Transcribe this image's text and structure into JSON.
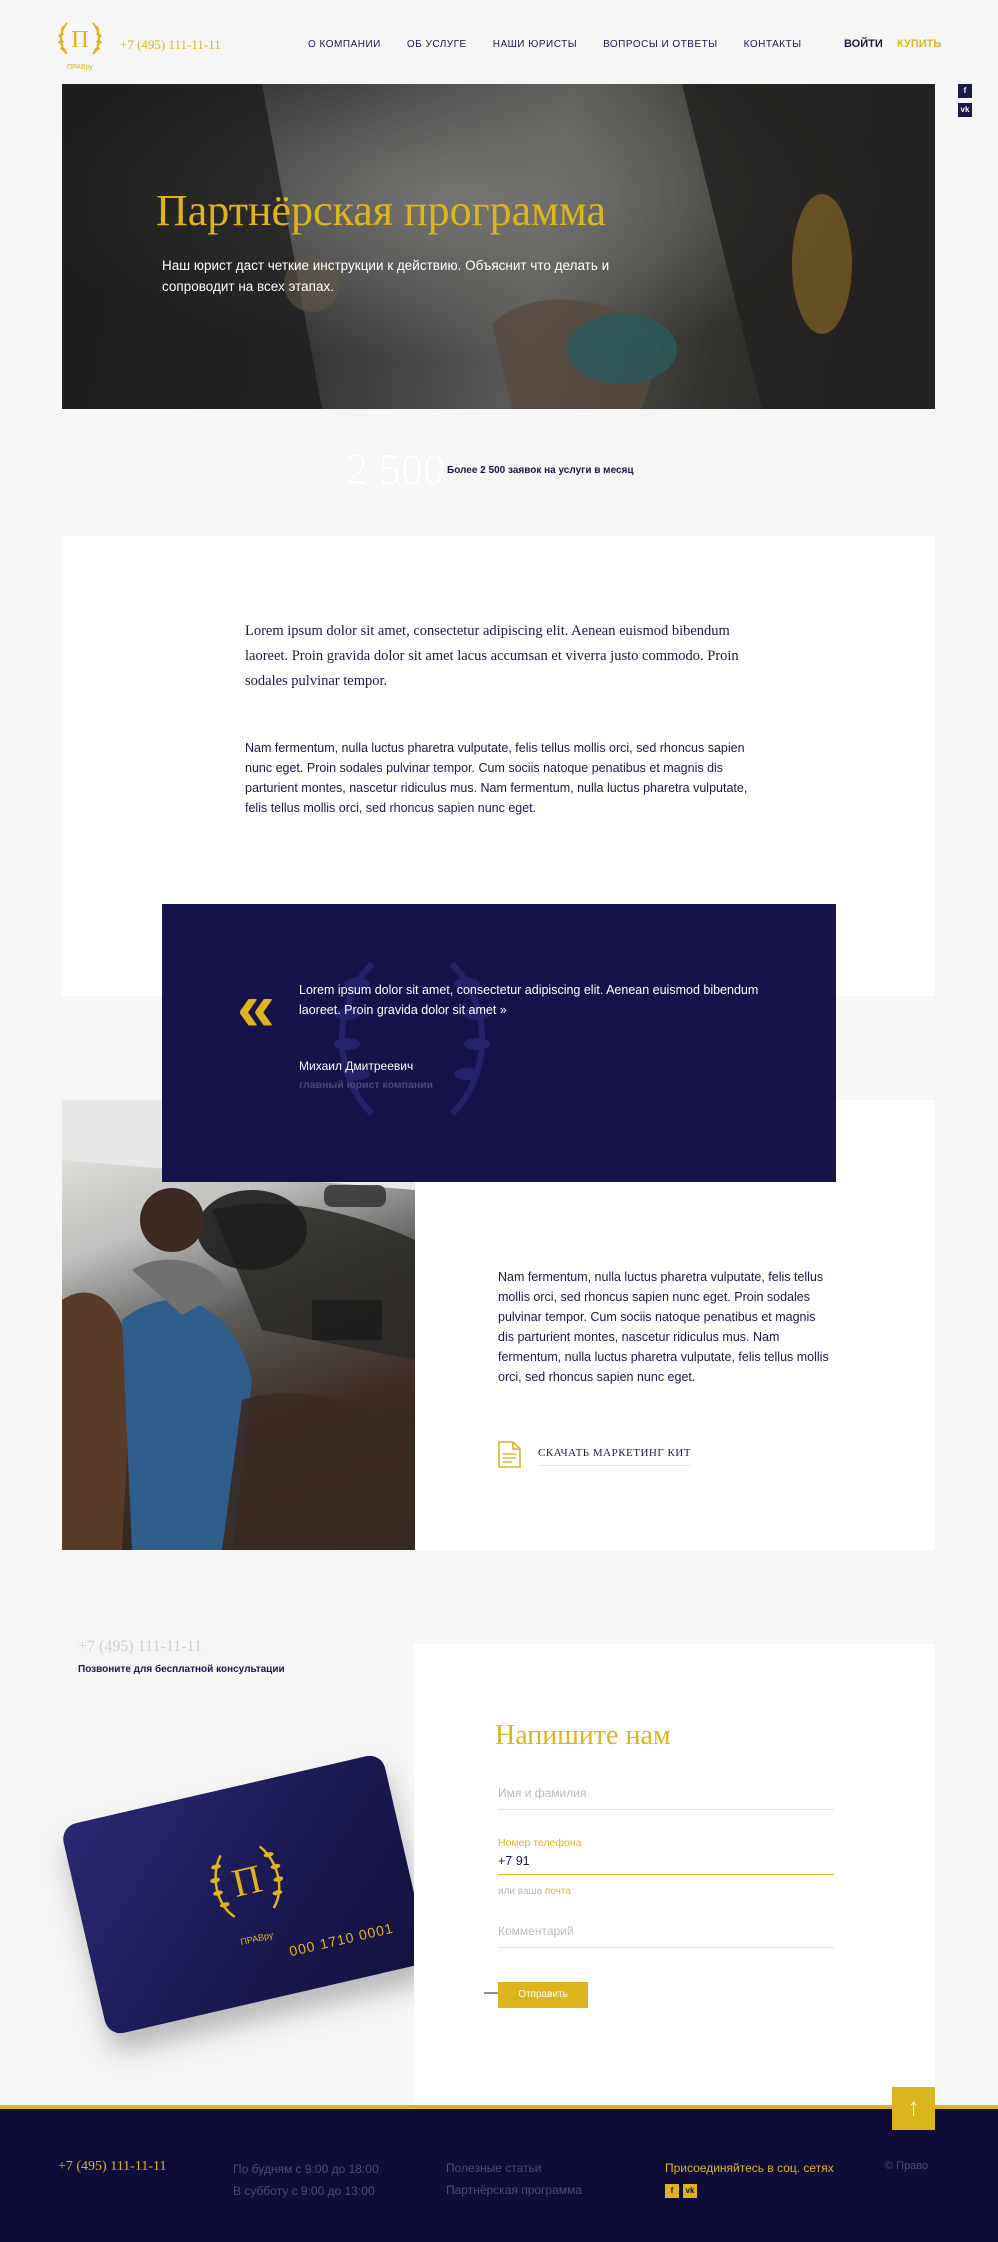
{
  "header": {
    "logo_letter": "П",
    "logo_word": "ПРАВру",
    "phone": "+7 (495) 111-11-11",
    "nav": [
      "О компании",
      "Об услуге",
      "Наши юристы",
      "Вопросы и ответы",
      "Контакты"
    ],
    "login": "ВОЙТИ",
    "buy": "КУПИТЬ",
    "side_social": [
      "f",
      "vk"
    ]
  },
  "hero": {
    "title": "Партнёрская программа",
    "subtitle": "Наш юрист даст четкие инструкции к действию. Объяснит что делать и сопроводит на всех этапах."
  },
  "stat": {
    "number": "2 500",
    "text": "Более 2 500 заявок на услуги  в месяц"
  },
  "intro": {
    "lead": "Lorem ipsum dolor sit amet, consectetur adipiscing elit. Aenean euismod bibendum laoreet. Proin gravida dolor sit amet lacus accumsan et viverra justo commodo. Proin sodales pulvinar tempor.",
    "body": "Nam fermentum, nulla luctus pharetra vulputate, felis tellus mollis orci, sed rhoncus sapien nunc eget. Proin sodales pulvinar tempor. Cum sociis natoque penatibus et magnis dis parturient montes, nascetur ridiculus mus. Nam fermentum, nulla luctus pharetra vulputate, felis tellus mollis orci, sed rhoncus sapien nunc eget."
  },
  "quote": {
    "mark": "«",
    "text": "Lorem ipsum dolor sit amet, consectetur adipiscing elit. Aenean euismod bibendum laoreet. Proin gravida dolor sit amet »",
    "author": "Михаил Дмитреевич",
    "role": "главный юрист компании"
  },
  "kit": {
    "body": "Nam fermentum, nulla luctus pharetra vulputate, felis tellus mollis orci, sed rhoncus sapien nunc eget. Proin sodales pulvinar tempor. Cum sociis natoque penatibus et magnis dis parturient montes, nascetur ridiculus mus. Nam fermentum, nulla luctus pharetra vulputate, felis tellus mollis orci, sed rhoncus sapien nunc eget.",
    "link": "Скачать маркетинг кит"
  },
  "contact": {
    "phone": "+7 (495) 111-11-11",
    "note": "Позвоните для бесплатной консультации",
    "card_number": "000 1710 0001",
    "card_letter": "П",
    "card_word": "ПРАВру"
  },
  "form": {
    "title": "Напишите нам",
    "name_placeholder": "Имя и фамилия",
    "phone_label": "Номер телефона",
    "phone_value": "+7 91",
    "hint_prefix": "или ваша",
    "hint_link": "почта",
    "comment_placeholder": "Комментарий",
    "submit": "Отправить"
  },
  "to_top": "↑",
  "footer": {
    "phone": "+7 (495) 111-11-11",
    "hours": [
      "По будням с 9:00 до 18:00",
      "В субботу с 9:00 до 13:00"
    ],
    "links": [
      "Полезные статьи",
      "Партнёрская программа"
    ],
    "join": "Присоединяйтесь в соц. сетях",
    "social": [
      "f",
      "vk"
    ],
    "copyright": "© Право"
  },
  "colors": {
    "accent": "#dcb41e",
    "navy": "#16134a",
    "footer": "#0f0d38"
  }
}
